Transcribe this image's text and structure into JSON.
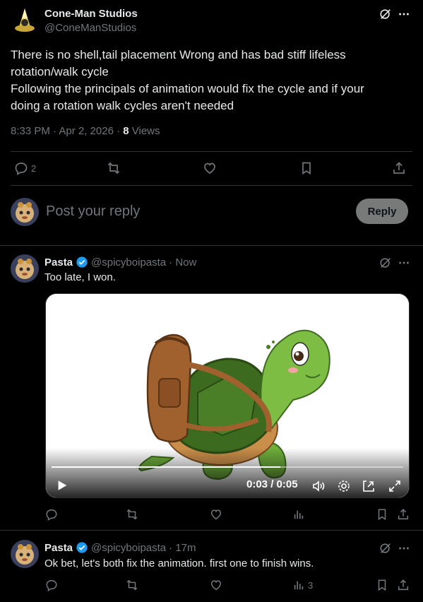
{
  "original_post": {
    "author_name": "Cone-Man Studios",
    "author_handle": "@ConeManStudios",
    "text_line1": "There is no shell,tail placement Wrong and has bad stiff lifeless",
    "text_line2": "rotation/walk cycle",
    "text_line3": "Following the principals of animation would fix the cycle and if your",
    "text_line4": "doing a rotation walk cycles aren't needed",
    "timestamp": "8:33 PM · Apr 2, 2026 · ",
    "views_count": "8",
    "views_label": " Views",
    "reply_count": "2",
    "more_icon": "more-dots-icon",
    "grok_icon": "grok-icon"
  },
  "reply_composer": {
    "placeholder": "Post your reply",
    "button_label": "Reply"
  },
  "replies": [
    {
      "author_name": "Pasta",
      "verified": true,
      "author_handle": "@spicyboipasta",
      "time": "· Now",
      "text": "Too late, I won.",
      "video": {
        "current_time": "0:03 / 0:05",
        "progress": 0.65
      },
      "views_count": ""
    },
    {
      "author_name": "Pasta",
      "verified": true,
      "author_handle": "@spicyboipasta",
      "time": "· 17m",
      "text": "Ok bet, let's both fix the animation. first one to finish wins.",
      "views_count": "3"
    }
  ],
  "colors": {
    "background": "#000000",
    "text": "#e7e9ea",
    "muted": "#71767b",
    "divider": "#2f3336",
    "verified": "#1d9bf0",
    "reply_button": "#787a7a"
  }
}
